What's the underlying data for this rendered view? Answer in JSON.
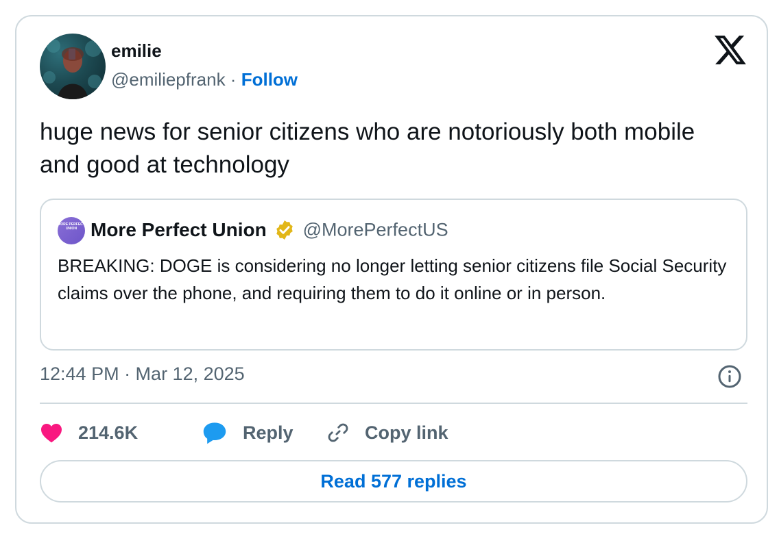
{
  "author": {
    "name": "emilie",
    "handle": "@emiliepfrank",
    "separator": "·",
    "follow_label": "Follow"
  },
  "tweet": {
    "text": "huge news for senior citizens who are notoriously both mobile and good at technology",
    "timestamp": "12:44 PM · Mar 12, 2025"
  },
  "quoted_tweet": {
    "avatar_text": "MORE PERFECT UNION",
    "name": "More Perfect Union",
    "handle": "@MorePerfectUS",
    "verified": true,
    "text": "BREAKING: DOGE is considering no longer letting senior citizens file Social Security claims over the phone, and requiring them to do it online or in person."
  },
  "actions": {
    "likes": "214.6K",
    "reply_label": "Reply",
    "copy_link_label": "Copy link"
  },
  "read_replies_label": "Read 577 replies",
  "colors": {
    "link_blue": "#006fd6",
    "like_pink": "#f91880",
    "reply_blue": "#1d9bf0",
    "verified_gold": "#e2b719",
    "secondary_text": "#536471",
    "border": "#cfd9de"
  },
  "icons": [
    "x-logo-icon",
    "heart-icon",
    "reply-bubble-icon",
    "link-icon",
    "info-icon",
    "verified-badge-icon"
  ]
}
